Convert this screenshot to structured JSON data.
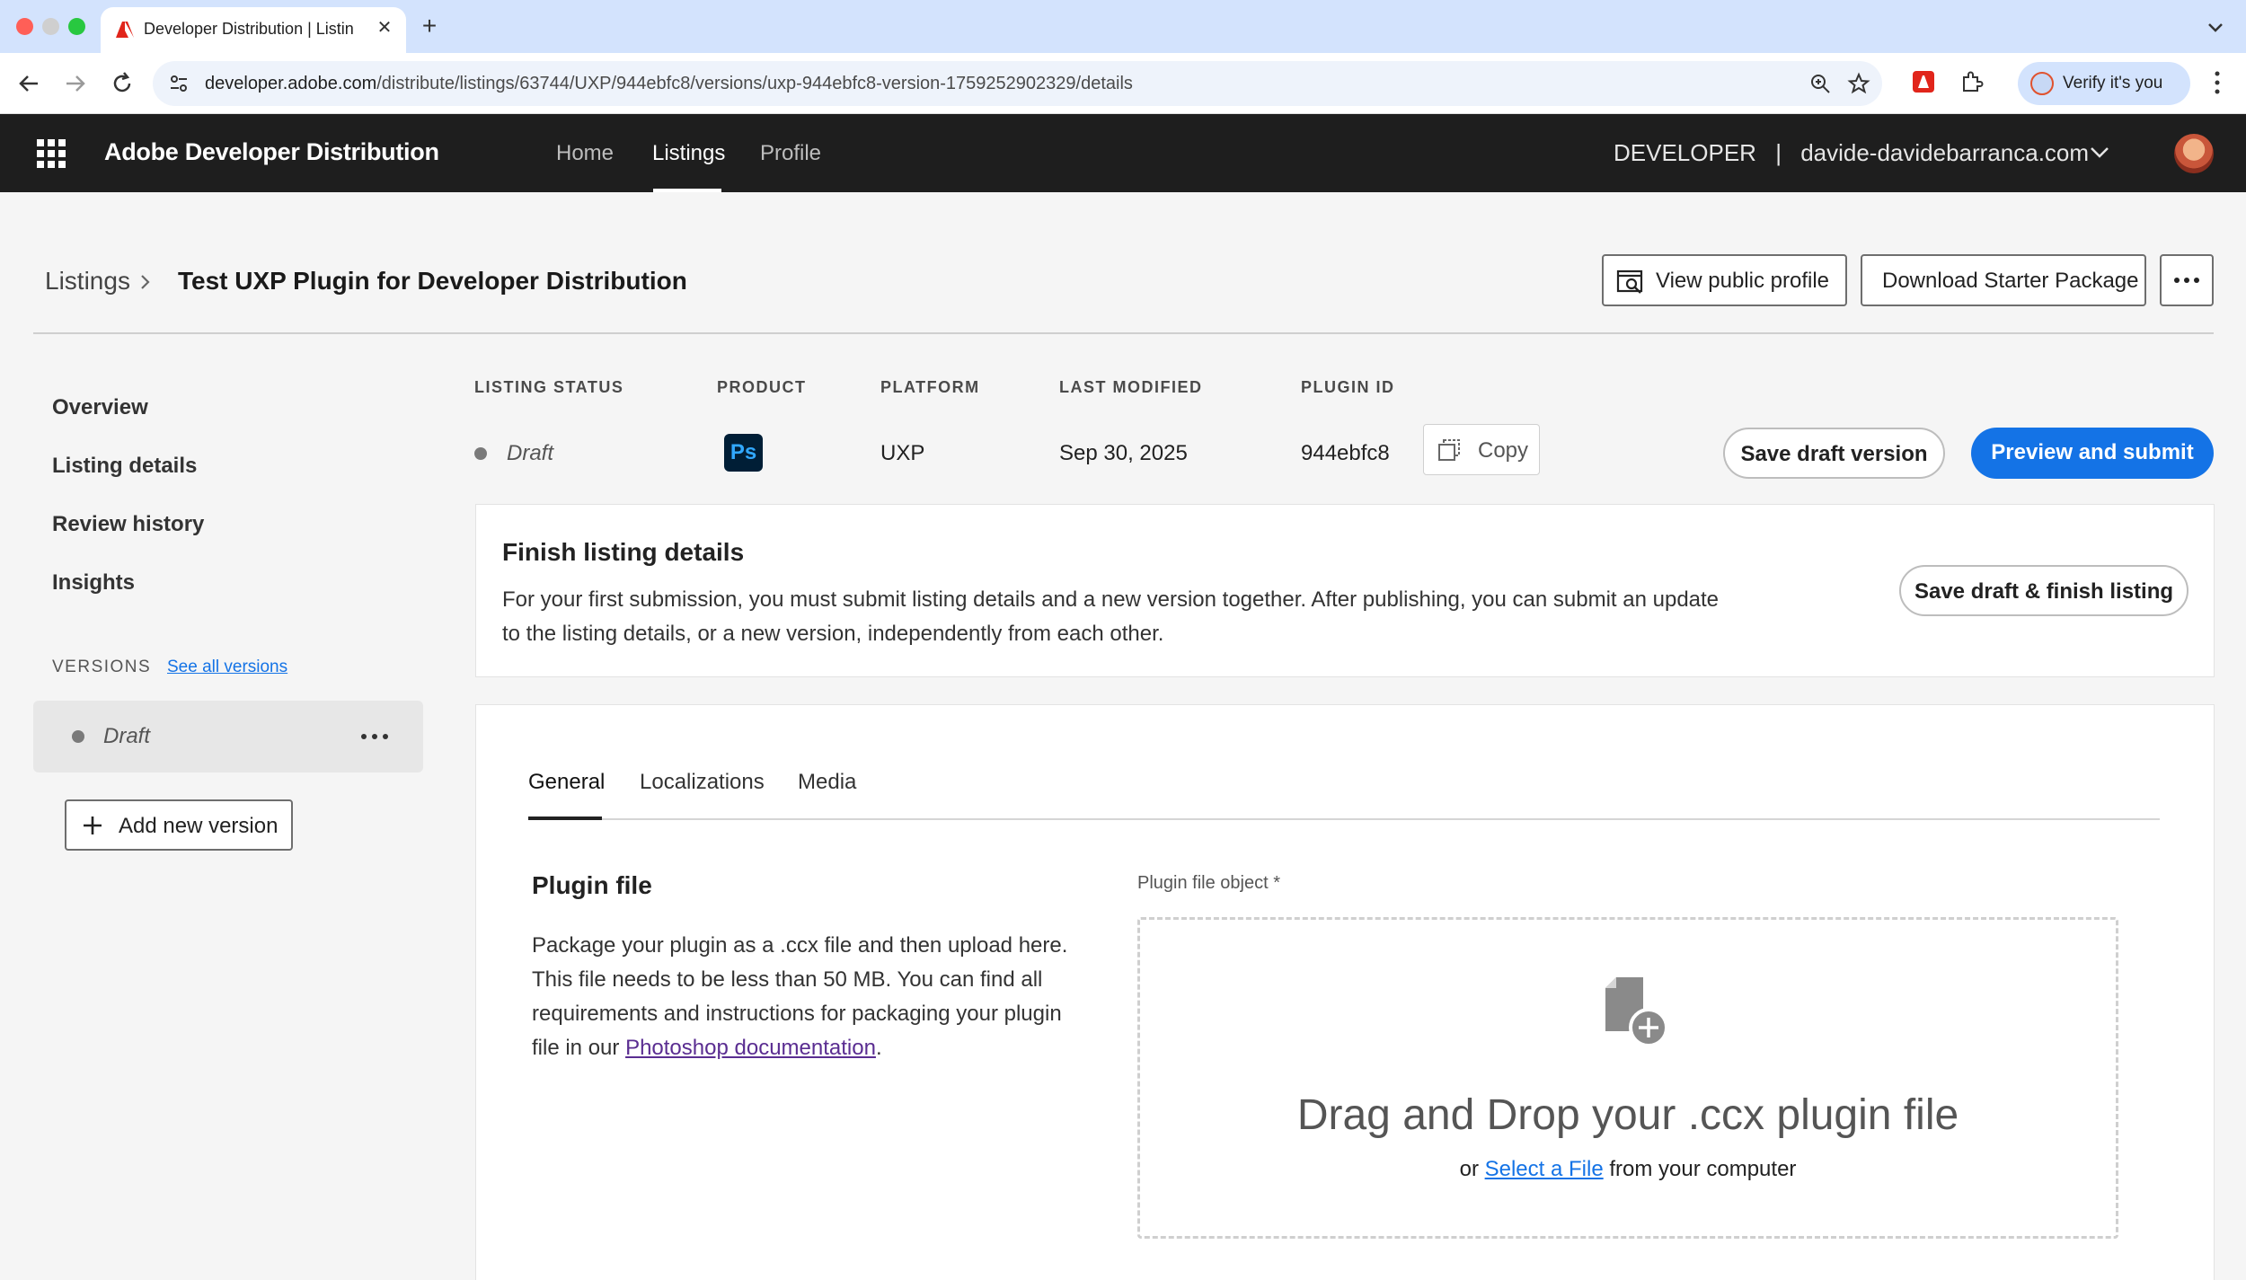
{
  "browser": {
    "tab_title": "Developer Distribution | Listin",
    "url_host": "developer.adobe.com",
    "url_path": "/distribute/listings/63744/UXP/944ebfc8/versions/uxp-944ebfc8-version-1759252902329/details",
    "verify_label": "Verify it's you"
  },
  "header": {
    "brand": "Adobe Developer Distribution",
    "nav": [
      "Home",
      "Listings",
      "Profile"
    ],
    "active_nav": "Listings",
    "role": "DEVELOPER",
    "separator": "|",
    "account": "davide-davidebarranca.com"
  },
  "page": {
    "breadcrumb_root": "Listings",
    "title": "Test UXP Plugin for Developer Distribution",
    "view_public_profile": "View public profile",
    "download_starter": "Download Starter Package"
  },
  "sidebar": {
    "items": [
      "Overview",
      "Listing details",
      "Review history",
      "Insights"
    ],
    "versions_label": "VERSIONS",
    "see_all": "See all versions",
    "version_draft": "Draft",
    "add_version": "Add new version"
  },
  "status": {
    "headers": [
      "LISTING STATUS",
      "PRODUCT",
      "PLATFORM",
      "LAST MODIFIED",
      "PLUGIN ID"
    ],
    "listing_status": "Draft",
    "product_icon": "Ps",
    "platform": "UXP",
    "last_modified": "Sep 30, 2025",
    "plugin_id": "944ebfc8",
    "copy_label": "Copy",
    "save_draft_version": "Save draft version",
    "preview_submit": "Preview and submit"
  },
  "finish": {
    "title": "Finish listing details",
    "body_line1": "For your first submission, you must submit listing details and a new version together. After publishing, you can submit an update",
    "body_line2": "to the listing details, or a new version, independently from each other.",
    "button": "Save draft & finish listing"
  },
  "tabs": [
    "General",
    "Localizations",
    "Media"
  ],
  "plugin_file": {
    "title": "Plugin file",
    "body_line1": "Package your plugin as a .ccx file and then upload here.",
    "body_line2": "This file needs to be less than 50 MB. You can find all",
    "body_line3": "requirements and instructions for packaging your plugin",
    "body_line4_prefix": "file in our ",
    "body_link": "Photoshop documentation",
    "body_line4_suffix": ".",
    "field_label": "Plugin file object *",
    "drop_title": "Drag and Drop your .ccx plugin file",
    "drop_or": "or ",
    "select_file": "Select a File",
    "drop_suffix": " from your computer"
  },
  "colors": {
    "accent": "#1473e6",
    "header_bg": "#1e1e1e",
    "tabbar_bg": "#d3e3fd"
  }
}
